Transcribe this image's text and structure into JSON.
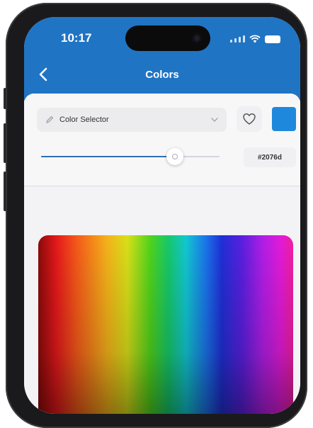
{
  "status_bar": {
    "time": "10:17"
  },
  "header": {
    "title": "Colors",
    "back_icon": "chevron-left-icon"
  },
  "selector": {
    "label": "Color Selector",
    "icon": "pencil-icon",
    "dropdown_icon": "chevron-down-icon"
  },
  "favorite": {
    "icon": "heart-outline-icon"
  },
  "current_color": {
    "swatch": "#1E88DC"
  },
  "slider": {
    "value": 0.75
  },
  "hex_field": {
    "value": "#2076d"
  },
  "colors": {
    "accent": "#2074C4",
    "background": "#F3F3F5"
  }
}
